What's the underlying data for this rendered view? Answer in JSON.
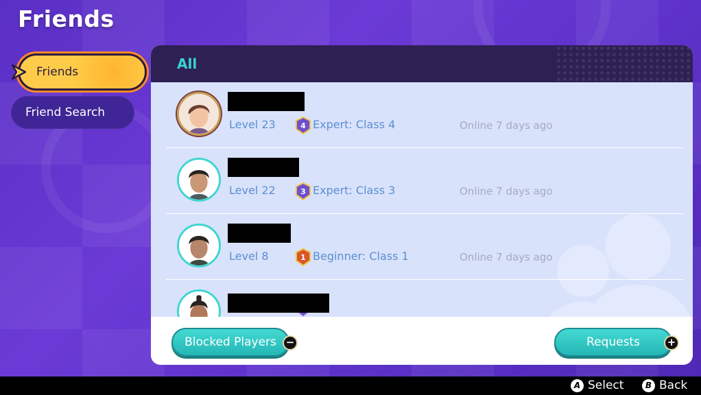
{
  "page": {
    "title": "Friends"
  },
  "sidebar": {
    "items": [
      {
        "label": "Friends",
        "selected": true
      },
      {
        "label": "Friend Search",
        "selected": false
      }
    ]
  },
  "panel": {
    "tab": "All",
    "friends": [
      {
        "level": "Level 23",
        "rank_number": "4",
        "rank": "Expert: Class 4",
        "status": "Online 7 days ago",
        "rank_color": "#6d4fcf"
      },
      {
        "level": "Level 22",
        "rank_number": "3",
        "rank": "Expert: Class 3",
        "status": "Online 7 days ago",
        "rank_color": "#6d4fcf"
      },
      {
        "level": "Level 8",
        "rank_number": "1",
        "rank": "Beginner: Class 1",
        "status": "Online 7 days ago",
        "rank_color": "#d9552c"
      }
    ],
    "footer": {
      "blocked_label": "Blocked Players",
      "blocked_glyph": "−",
      "requests_label": "Requests",
      "requests_glyph": "+"
    }
  },
  "controls": {
    "select_button": "A",
    "select_label": "Select",
    "back_button": "B",
    "back_label": "Back"
  },
  "colors": {
    "accent_teal": "#39d3d0",
    "selected_yellow": "#ffcc4a",
    "panel_list": "#d9e2fb",
    "header_dark": "#2f2054"
  }
}
